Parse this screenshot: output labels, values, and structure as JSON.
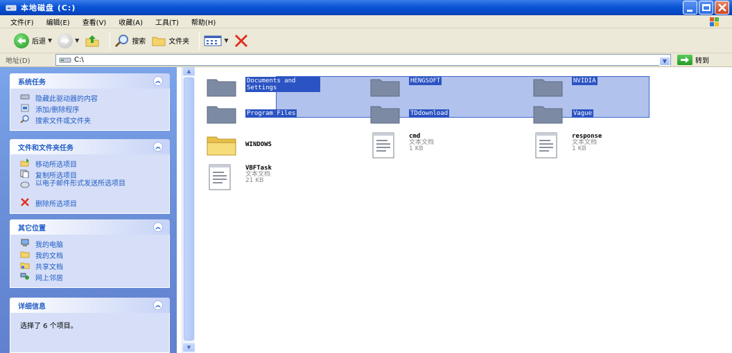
{
  "window": {
    "title": "本地磁盘 (C:)"
  },
  "menu": {
    "items": [
      "文件(F)",
      "编辑(E)",
      "查看(V)",
      "收藏(A)",
      "工具(T)",
      "帮助(H)"
    ]
  },
  "toolbar": {
    "back_label": "后退",
    "search_label": "搜索",
    "folders_label": "文件夹"
  },
  "address": {
    "label": "地址(D)",
    "value": "C:\\",
    "go_label": "转到"
  },
  "panels": {
    "system": {
      "title": "系统任务",
      "items": [
        "隐藏此驱动器的内容",
        "添加/删除程序",
        "搜索文件或文件夹"
      ]
    },
    "file": {
      "title": "文件和文件夹任务",
      "items": [
        "移动所选项目",
        "复制所选项目",
        "以电子邮件形式发送所选项目",
        "删除所选项目"
      ]
    },
    "other": {
      "title": "其它位置",
      "items": [
        "我的电脑",
        "我的文档",
        "共享文档",
        "网上邻居"
      ]
    },
    "details": {
      "title": "详细信息",
      "text": "选择了 6 个项目。"
    }
  },
  "files": {
    "folders": [
      {
        "name": "Documents and Settings",
        "selected": true
      },
      {
        "name": "HENGSOFT",
        "selected": true
      },
      {
        "name": "NVIDIA",
        "selected": true
      },
      {
        "name": "Program Files",
        "selected": true
      },
      {
        "name": "TDdownload",
        "selected": true
      },
      {
        "name": "Vague",
        "selected": true
      },
      {
        "name": "WINDOWS",
        "selected": false
      }
    ],
    "texts": [
      {
        "name": "cmd",
        "type": "文本文档",
        "size": "1 KB"
      },
      {
        "name": "response",
        "type": "文本文档",
        "size": "1 KB"
      },
      {
        "name": "VBFTask",
        "type": "文本文档",
        "size": "21 KB"
      }
    ]
  }
}
